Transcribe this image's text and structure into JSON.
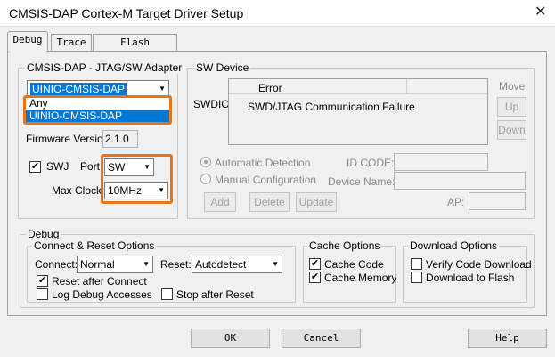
{
  "window": {
    "title": "CMSIS-DAP Cortex-M Target Driver Setup",
    "close_glyph": "✕"
  },
  "tabs": [
    {
      "label": "Debug"
    },
    {
      "label": "Trace"
    },
    {
      "label": "Flash Download"
    }
  ],
  "adapter": {
    "group_label": "CMSIS-DAP - JTAG/SW Adapter",
    "selected": "UINIO-CMSIS-DAP",
    "dropdown_options": [
      "Any",
      "UINIO-CMSIS-DAP"
    ],
    "firmware_label": "Firmware Version:",
    "firmware_value": "2.1.0",
    "swj_label": "SWJ",
    "swj_checked": "✔",
    "port_label": "Port:",
    "port_value": "SW",
    "maxclock_label": "Max Clock:",
    "maxclock_value": "10MHz"
  },
  "sw_device": {
    "group_label": "SW Device",
    "swdio_label": "SWDIO",
    "col_error": "Error",
    "row_message": "SWD/JTAG Communication Failure",
    "move_label": "Move",
    "up_label": "Up",
    "down_label": "Down",
    "auto_label": "Automatic Detection",
    "manual_label": "Manual Configuration",
    "idcode_label": "ID CODE:",
    "devname_label": "Device Name:",
    "add_label": "Add",
    "delete_label": "Delete",
    "update_label": "Update",
    "ap_label": "AP:"
  },
  "debug": {
    "group_label": "Debug",
    "connect_reset_label": "Connect & Reset Options",
    "connect_label": "Connect:",
    "connect_value": "Normal",
    "reset_label": "Reset:",
    "reset_value": "Autodetect",
    "reset_after_connect": "Reset after Connect",
    "log_debug": "Log Debug Accesses",
    "stop_after_reset": "Stop after Reset",
    "cache_label": "Cache Options",
    "cache_code": "Cache Code",
    "cache_memory": "Cache Memory",
    "download_label": "Download Options",
    "verify_code": "Verify Code Download",
    "download_flash": "Download to Flash",
    "check_glyph": "✔"
  },
  "footer": {
    "ok": "OK",
    "cancel": "Cancel",
    "help": "Help"
  },
  "colors": {
    "highlight": "#e8751a",
    "selection": "#0078d7"
  }
}
